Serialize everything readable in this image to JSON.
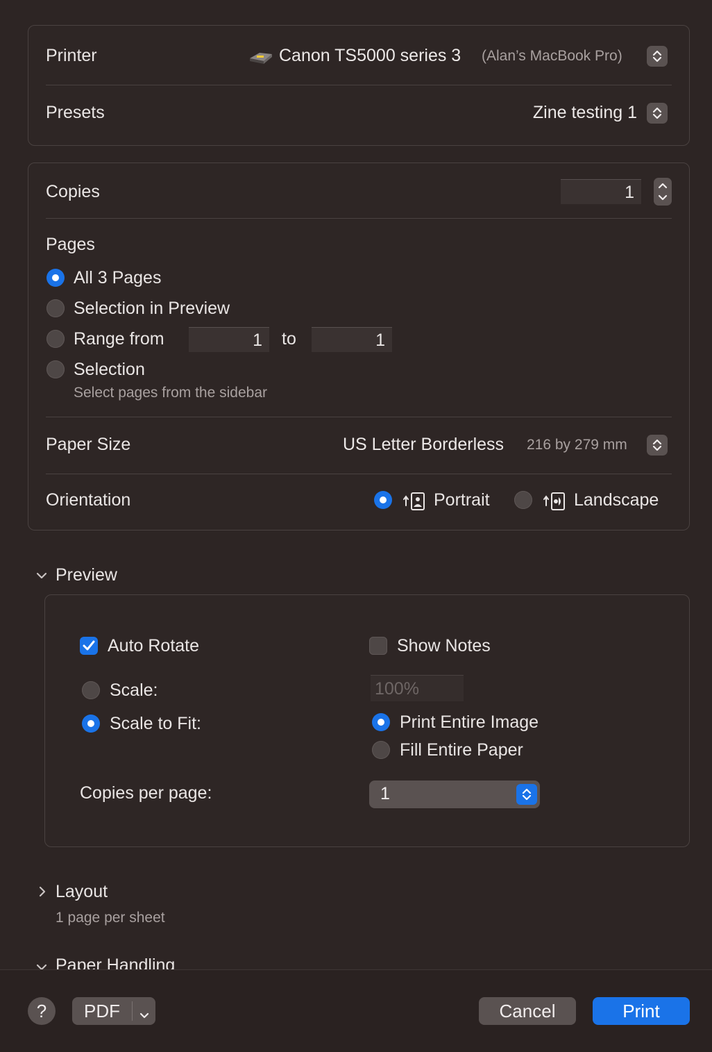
{
  "printer": {
    "label": "Printer",
    "name": "Canon TS5000 series 3",
    "host": "(Alan’s MacBook Pro)",
    "icon": "printer-icon"
  },
  "presets": {
    "label": "Presets",
    "value": "Zine testing 1"
  },
  "copies": {
    "label": "Copies",
    "value": "1"
  },
  "pages": {
    "label": "Pages",
    "options": {
      "all": "All 3 Pages",
      "selection_preview": "Selection in Preview",
      "range": "Range from",
      "range_to": "to",
      "selection": "Selection",
      "selection_hint": "Select pages from the sidebar"
    },
    "range_from": "1",
    "range_to_value": "1",
    "selected": "all"
  },
  "paper_size": {
    "label": "Paper Size",
    "value": "US Letter Borderless",
    "dims": "216 by 279 mm"
  },
  "orientation": {
    "label": "Orientation",
    "portrait": "Portrait",
    "landscape": "Landscape",
    "selected": "portrait"
  },
  "preview": {
    "title": "Preview",
    "auto_rotate": "Auto Rotate",
    "show_notes": "Show Notes",
    "scale": "Scale:",
    "scale_value": "100%",
    "scale_to_fit": "Scale to Fit:",
    "print_entire_image": "Print Entire Image",
    "fill_entire_paper": "Fill Entire Paper",
    "copies_per_page": "Copies per page:",
    "copies_per_page_value": "1"
  },
  "layout": {
    "title": "Layout",
    "summary": "1 page per sheet"
  },
  "paper_handling": {
    "title": "Paper Handling"
  },
  "footer": {
    "help": "?",
    "pdf": "PDF",
    "cancel": "Cancel",
    "print": "Print"
  },
  "colors": {
    "accent": "#1a73e8",
    "background": "#2d2524"
  }
}
